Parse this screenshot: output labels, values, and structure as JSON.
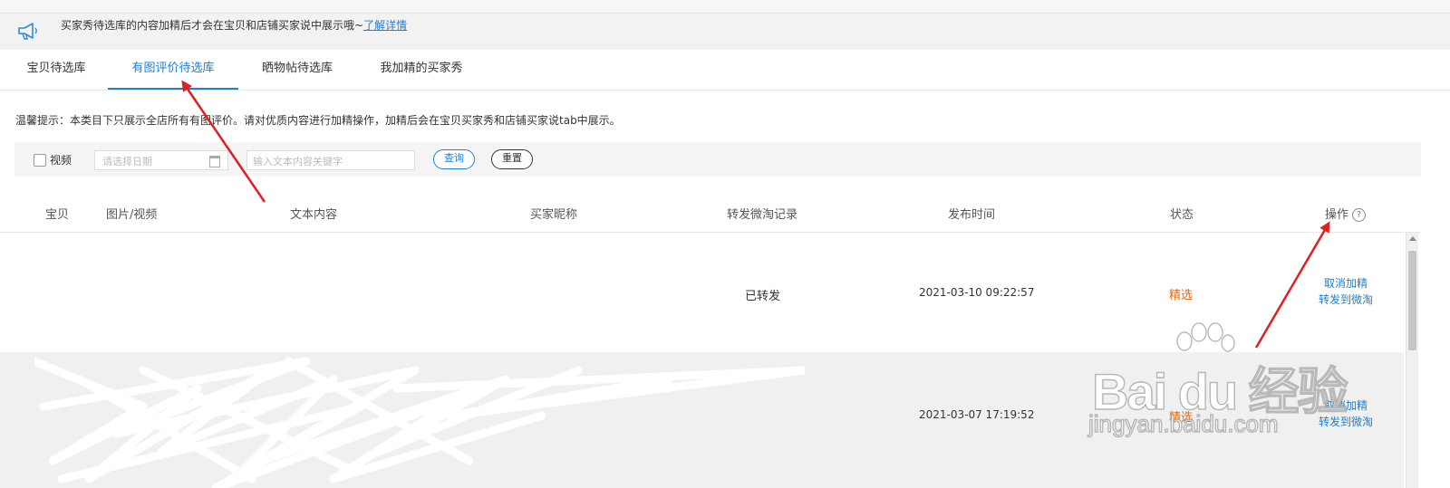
{
  "notice": {
    "text": "买家秀待选库的内容加精后才会在宝贝和店铺买家说中展示哦~",
    "link": "了解详情"
  },
  "tabs": [
    {
      "label": "宝贝待选库"
    },
    {
      "label": "有图评价待选库"
    },
    {
      "label": "晒物帖待选库"
    },
    {
      "label": "我加精的买家秀"
    }
  ],
  "tip": "温馨提示：本类目下只展示全店所有有图评价。请对优质内容进行加精操作，加精后会在宝贝买家秀和店铺买家说tab中展示。",
  "filter": {
    "video_label": "视频",
    "date_placeholder": "请选择日期",
    "keyword_placeholder": "输入文本内容关键字",
    "query_label": "查询",
    "reset_label": "重置"
  },
  "table": {
    "headers": {
      "item": "宝贝",
      "media": "图片/视频",
      "text": "文本内容",
      "nickname": "买家昵称",
      "forward": "转发微淘记录",
      "time": "发布时间",
      "status": "状态",
      "action": "操作"
    },
    "rows": [
      {
        "forward": "已转发",
        "time": "2021-03-10 09:22:57",
        "status": "精选",
        "actions": [
          "取消加精",
          "转发到微淘"
        ]
      },
      {
        "forward": "",
        "time": "2021-03-07 17:19:52",
        "status": "精选",
        "actions": [
          "取消加精",
          "转发到微淘"
        ]
      }
    ]
  },
  "watermark": {
    "main": "Bai du 经验",
    "sub": "jingyan.baidu.com"
  },
  "colors": {
    "accent": "#1f7fd0",
    "status": "#e06a14",
    "annotation": "#e02020"
  }
}
